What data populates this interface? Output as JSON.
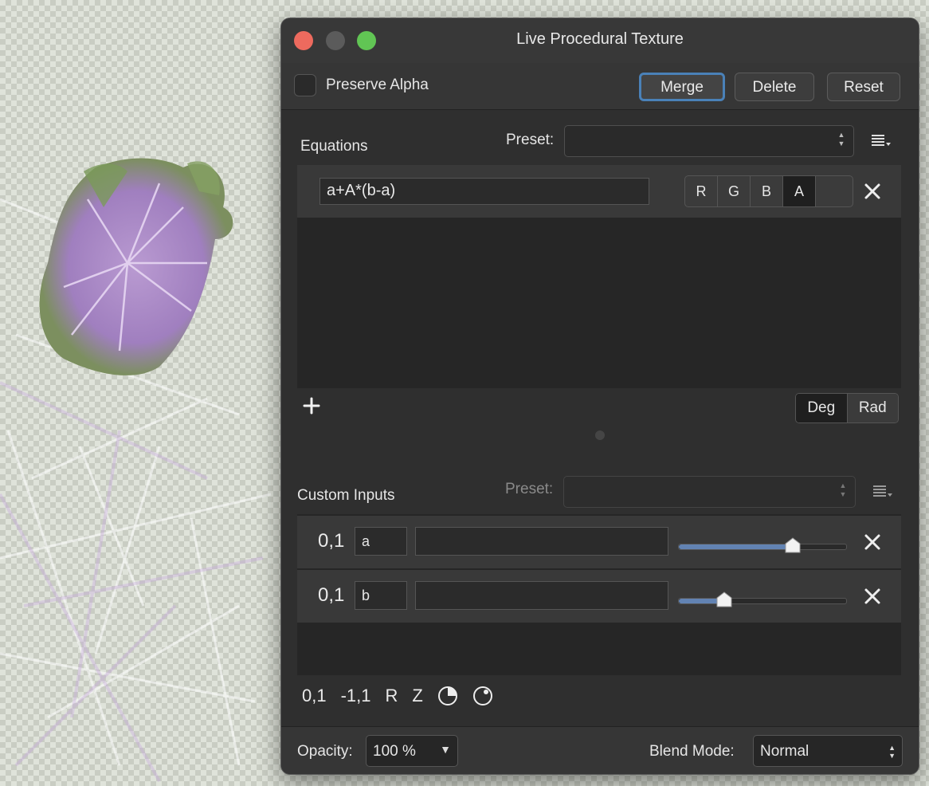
{
  "window": {
    "title": "Live Procedural Texture"
  },
  "toolbar": {
    "preserve_alpha_label": "Preserve Alpha",
    "merge_label": "Merge",
    "delete_label": "Delete",
    "reset_label": "Reset"
  },
  "equations": {
    "section_label": "Equations",
    "preset_label": "Preset:",
    "preset_value": "",
    "rows": [
      {
        "expression": "a+A*(b-a)",
        "channels": [
          "R",
          "G",
          "B",
          "A",
          ""
        ],
        "active_channel": "A"
      }
    ],
    "angle_units": {
      "deg_label": "Deg",
      "rad_label": "Rad",
      "selected": "Deg"
    }
  },
  "custom_inputs": {
    "section_label": "Custom Inputs",
    "preset_label": "Preset:",
    "rows": [
      {
        "range": "0,1",
        "name": "a",
        "expression": "",
        "value": 0.68
      },
      {
        "range": "0,1",
        "name": "b",
        "expression": "",
        "value": 0.27
      }
    ],
    "range_buttons": [
      "0,1",
      "-1,1",
      "R",
      "Z"
    ]
  },
  "footer": {
    "opacity_label": "Opacity:",
    "opacity_value": "100 %",
    "blend_label": "Blend Mode:",
    "blend_value": "Normal"
  },
  "colors": {
    "panel_bg": "#2f2f2f",
    "accent": "#4a81b8",
    "slider_fill": "#6283b3",
    "close_red": "#ed6a5e",
    "zoom_green": "#61c554"
  }
}
